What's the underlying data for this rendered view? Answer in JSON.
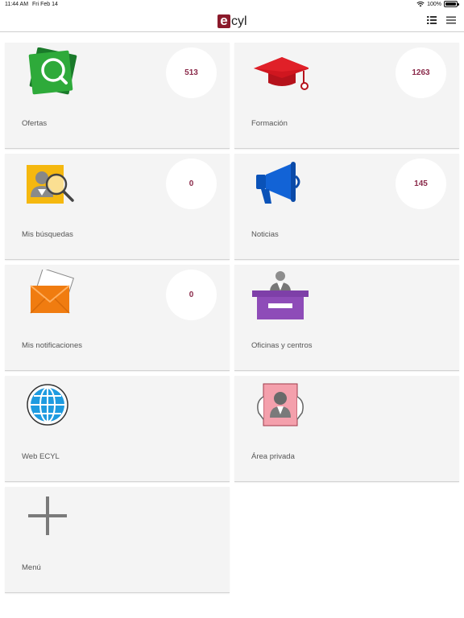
{
  "status": {
    "time": "11:44 AM",
    "date": "Fri Feb 14",
    "battery": "100%"
  },
  "header": {
    "logo_letter": "e",
    "logo_text": "cyl"
  },
  "colors": {
    "brand": "#8b1a2b",
    "badge_text": "#8a2a4a",
    "tile_bg": "#f4f4f4"
  },
  "tiles": [
    {
      "label": "Ofertas",
      "count": "513",
      "icon": "search-offers-icon"
    },
    {
      "label": "Formación",
      "count": "1263",
      "icon": "graduation-cap-icon"
    },
    {
      "label": "Mis búsquedas",
      "count": "0",
      "icon": "person-search-icon"
    },
    {
      "label": "Noticias",
      "count": "145",
      "icon": "megaphone-icon"
    },
    {
      "label": "Mis notificaciones",
      "count": "0",
      "icon": "envelope-icon"
    },
    {
      "label": "Oficinas y centros",
      "icon": "office-desk-icon"
    },
    {
      "label": "Web ECYL",
      "icon": "globe-icon"
    },
    {
      "label": "Área privada",
      "icon": "private-area-icon"
    },
    {
      "label": "Menú",
      "icon": "plus-icon"
    }
  ]
}
